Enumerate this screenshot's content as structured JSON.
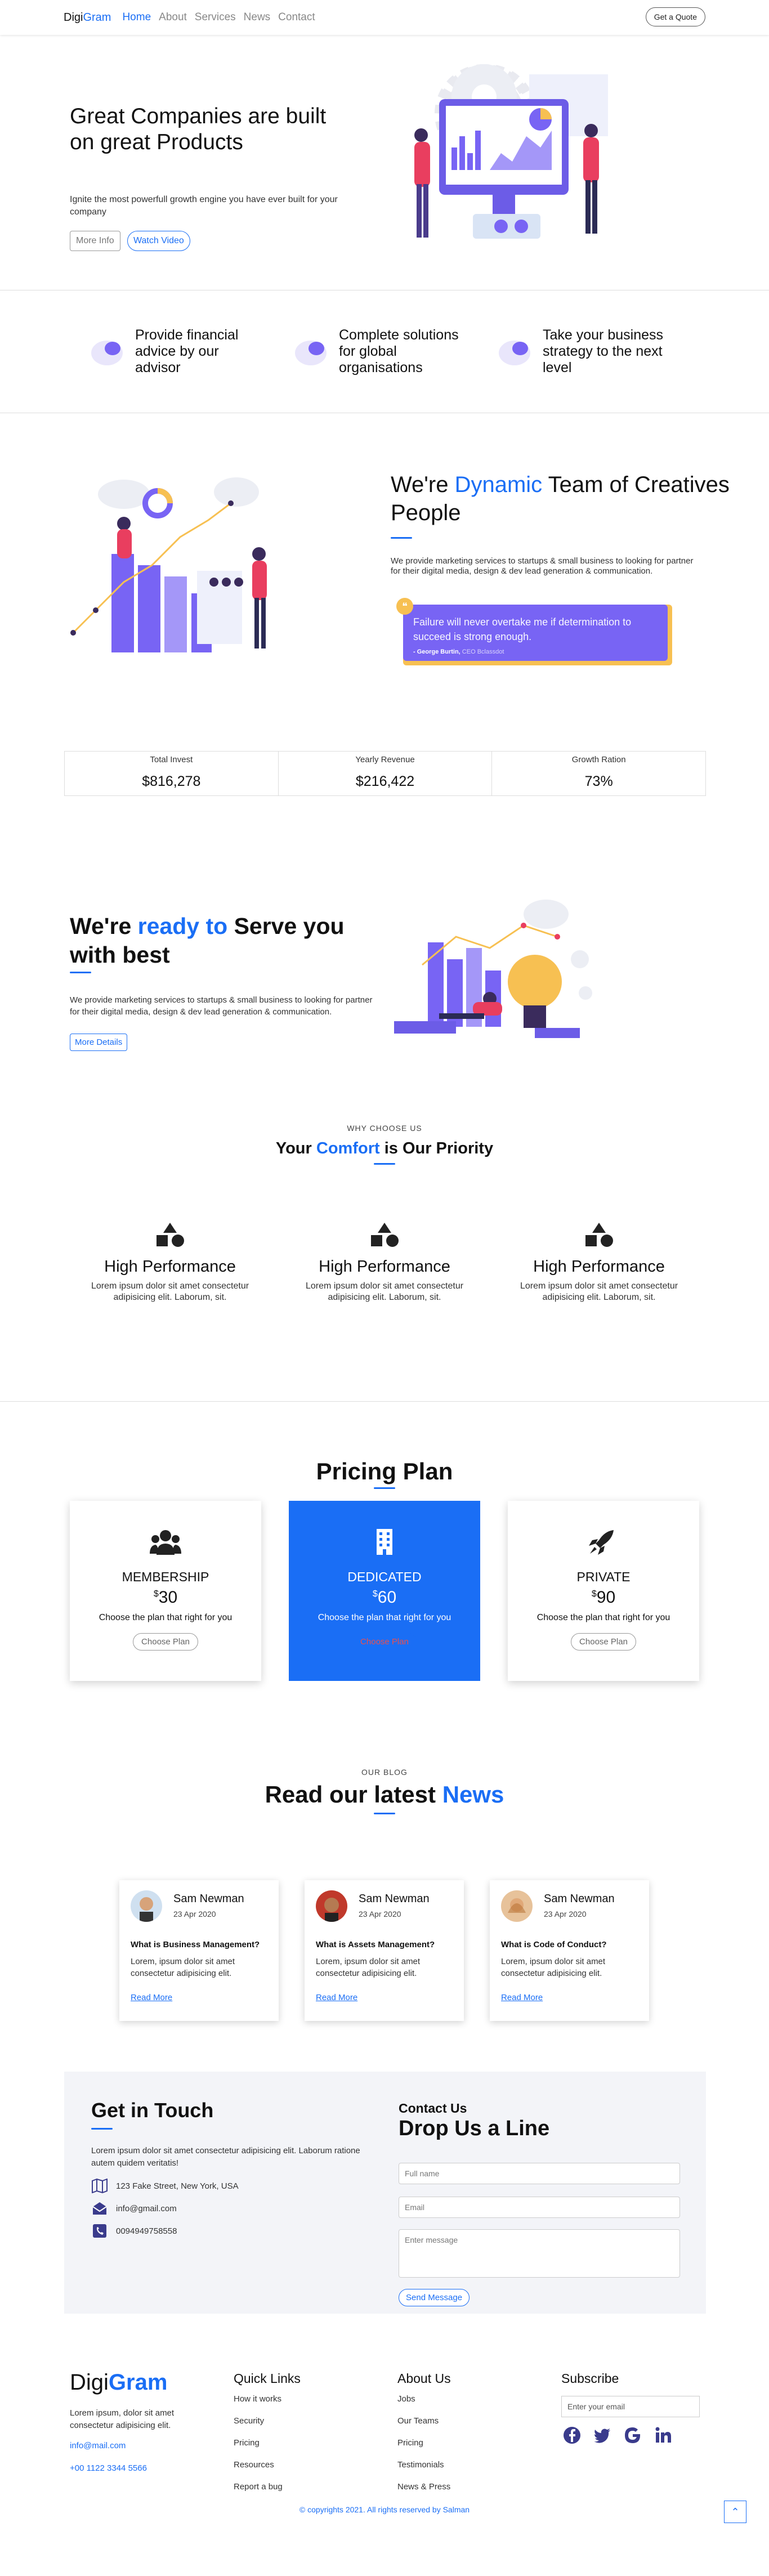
{
  "nav": {
    "brand_a": "Digi",
    "brand_b": "Gram",
    "links": [
      "Home",
      "About",
      "Services",
      "News",
      "Contact"
    ],
    "cta": "Get a Quote"
  },
  "hero": {
    "title": "Great Companies are built on great Products",
    "subtitle": "Ignite the most powerfull growth engine you have ever built for your company",
    "btn1": "More Info",
    "btn2": "Watch Video"
  },
  "features": [
    "Provide financial advice by our advisor",
    "Complete solutions for global organisations",
    "Take your business strategy to the next level"
  ],
  "team": {
    "title_a": "We're ",
    "title_b": "Dynamic",
    "title_c": " Team of Creatives People",
    "desc": "We provide marketing services to startups & small business to looking for partner for their digital media, design & dev lead generation & communication.",
    "quote": "Failure will never overtake me if determination to succeed is strong enough.",
    "author": "- George Burtin,",
    "author_role": "CEO Bclassdot"
  },
  "stats": [
    {
      "label": "Total Invest",
      "value": "$816,278"
    },
    {
      "label": "Yearly Revenue",
      "value": "$216,422"
    },
    {
      "label": "Growth Ration",
      "value": "73%"
    }
  ],
  "serve": {
    "title_a": "We're ",
    "title_b": "ready to",
    "title_c": " Serve you with best",
    "desc": "We provide marketing services to startups & small business to looking for partner for their digital media, design & dev lead generation & communication.",
    "btn": "More Details"
  },
  "why": {
    "eyebrow": "WHY CHOOSE US",
    "title_a": "Your ",
    "title_b": "Comfort",
    "title_c": " is Our Priority",
    "items": [
      {
        "title": "High Performance",
        "desc": "Lorem ipsum dolor sit amet consectetur adipisicing elit. Laborum, sit."
      },
      {
        "title": "High Performance",
        "desc": "Lorem ipsum dolor sit amet consectetur adipisicing elit. Laborum, sit."
      },
      {
        "title": "High Performance",
        "desc": "Lorem ipsum dolor sit amet consectetur adipisicing elit. Laborum, sit."
      }
    ]
  },
  "pricing": {
    "title": "Pricing Plan",
    "plans": [
      {
        "name": "MEMBERSHIP",
        "currency": "$",
        "price": "30",
        "desc": "Choose the plan that right for you",
        "btn": "Choose Plan",
        "icon": "users-icon"
      },
      {
        "name": "DEDICATED",
        "currency": "$",
        "price": "60",
        "desc": "Choose the plan that right for you",
        "btn": "Choose Plan",
        "icon": "building-icon"
      },
      {
        "name": "PRIVATE",
        "currency": "$",
        "price": "90",
        "desc": "Choose the plan that right for you",
        "btn": "Choose Plan",
        "icon": "rocket-icon"
      }
    ]
  },
  "blog": {
    "eyebrow": "OUR BLOG",
    "title_a": "Read our latest ",
    "title_b": "News",
    "posts": [
      {
        "author": "Sam Newman",
        "date": "23 Apr 2020",
        "q": "What is Business Management?",
        "text": "Lorem, ipsum dolor sit amet consectetur adipisicing elit.",
        "link": "Read More"
      },
      {
        "author": "Sam Newman",
        "date": "23 Apr 2020",
        "q": "What is Assets Management?",
        "text": "Lorem, ipsum dolor sit amet consectetur adipisicing elit.",
        "link": "Read More"
      },
      {
        "author": "Sam Newman",
        "date": "23 Apr 2020",
        "q": "What is Code of Conduct?",
        "text": "Lorem, ipsum dolor sit amet consectetur adipisicing elit.",
        "link": "Read More"
      }
    ]
  },
  "contact": {
    "title": "Get in Touch",
    "desc": "Lorem ipsum dolor sit amet consectetur adipisicing elit. Laborum ratione autem quidem veritatis!",
    "address": "123 Fake Street, New York, USA",
    "email": "info@gmail.com",
    "phone": "0094949758558",
    "form_eyebrow": "Contact Us",
    "form_title": "Drop Us a Line",
    "ph_name": "Full name",
    "ph_email": "Email",
    "ph_msg": "Enter message",
    "send": "Send Message"
  },
  "footer": {
    "brand_a": "Digi",
    "brand_b": "Gram",
    "desc": "Lorem ipsum, dolor sit amet consectetur adipisicing elit.",
    "email": "info@mail.com",
    "phone": "+00 1122 3344 5566",
    "quick_title": "Quick Links",
    "quick": [
      "How it works",
      "Security",
      "Pricing",
      "Resources",
      "Report a bug"
    ],
    "about_title": "About Us",
    "about": [
      "Jobs",
      "Our Teams",
      "Pricing",
      "Testimonials",
      "News & Press"
    ],
    "sub_title": "Subscribe",
    "sub_ph": "Enter your email",
    "copyright": "© copyrights 2021. All rights reserved by Salman",
    "social": [
      "facebook-icon",
      "twitter-icon",
      "google-icon",
      "linkedin-icon"
    ]
  },
  "colors": {
    "accent": "#1a6ef5",
    "purple": "#7864f4",
    "yellow": "#f7c052"
  }
}
